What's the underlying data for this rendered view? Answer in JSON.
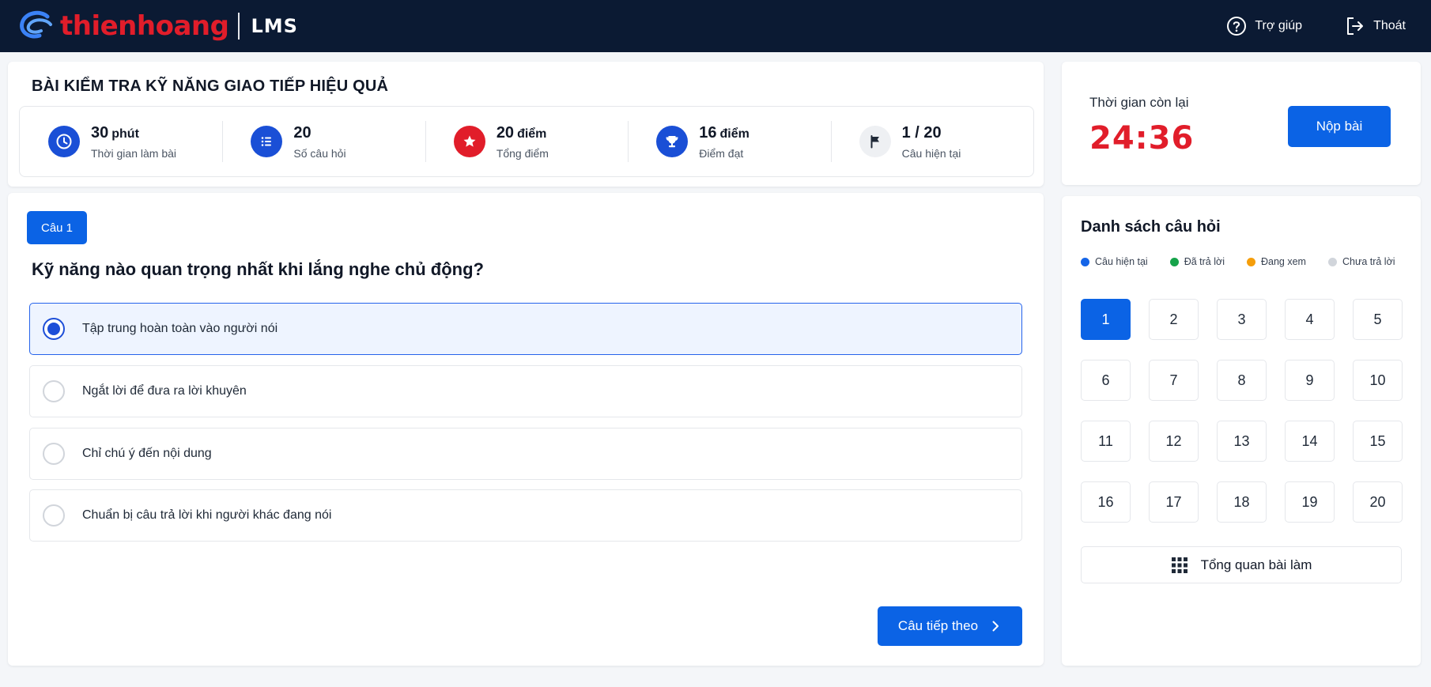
{
  "brand": {
    "name": "thienhoang",
    "product": "LMS"
  },
  "top_actions": {
    "help_label": "Trợ giúp",
    "logout_label": "Thoát"
  },
  "exam": {
    "title": "BÀI KIỂM TRA KỸ NĂNG GIAO TIẾP HIỆU QUẢ",
    "stats": [
      {
        "value": "30",
        "unit": "phút",
        "label": "Thời gian làm bài",
        "icon": "clock-icon",
        "color": "#1a4fd6"
      },
      {
        "value": "20",
        "unit": "",
        "label": "Số câu hỏi",
        "icon": "list-icon",
        "color": "#1a4fd6"
      },
      {
        "value": "20",
        "unit": "điểm",
        "label": "Tổng điểm",
        "icon": "star-icon",
        "color": "#e11d2a"
      },
      {
        "value": "16",
        "unit": "điểm",
        "label": "Điểm đạt",
        "icon": "trophy-icon",
        "color": "#1a4fd6"
      },
      {
        "value": "1 / 20",
        "unit": "",
        "label": "Câu hiện tại",
        "icon": "flag-icon",
        "color": "#eef0f3"
      }
    ]
  },
  "question": {
    "badge": "Câu 1",
    "text": "Kỹ năng nào quan trọng nhất khi lắng nghe chủ động?",
    "options": [
      {
        "text": "Tập trung hoàn toàn vào người nói",
        "selected": true
      },
      {
        "text": "Ngắt lời để đưa ra lời khuyên",
        "selected": false
      },
      {
        "text": "Chỉ chú ý đến nội dung",
        "selected": false
      },
      {
        "text": "Chuẩn bị câu trả lời khi người khác đang nói",
        "selected": false
      }
    ],
    "next_label": "Câu tiếp theo"
  },
  "timer": {
    "label": "Thời gian còn lại",
    "value": "24:36",
    "submit_label": "Nộp bài"
  },
  "question_list": {
    "title": "Danh sách câu hỏi",
    "legend": [
      {
        "label": "Câu hiện tại",
        "color": "#1565e8"
      },
      {
        "label": "Đã trả lời",
        "color": "#16a34a"
      },
      {
        "label": "Đang xem",
        "color": "#f59e0b"
      },
      {
        "label": "Chưa trả lời",
        "color": "#d1d5db"
      }
    ],
    "numbers": [
      "1",
      "2",
      "3",
      "4",
      "5",
      "6",
      "7",
      "8",
      "9",
      "10",
      "11",
      "12",
      "13",
      "14",
      "15",
      "16",
      "17",
      "18",
      "19",
      "20"
    ],
    "current": "1",
    "overview_label": "Tổng quan bài làm"
  },
  "colors": {
    "accent": "#0b63e5",
    "topbar": "#0b1a33",
    "timer": "#e11d2a"
  }
}
